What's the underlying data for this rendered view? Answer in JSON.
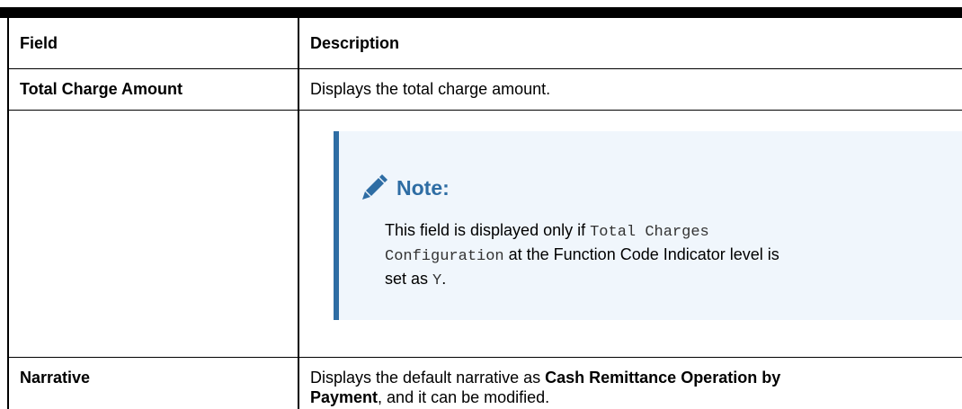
{
  "table": {
    "headers": {
      "field": "Field",
      "description": "Description"
    },
    "rows": [
      {
        "field": "Total Charge Amount",
        "description": "Displays the total charge amount.",
        "note": {
          "title": "Note:",
          "text_1": "This field is displayed only if ",
          "code_1": "Total Charges",
          "code_2": "Configuration",
          "text_2": " at the Function Code Indicator level is",
          "text_3": "set as ",
          "code_3": "Y",
          "text_4": "."
        }
      },
      {
        "field": "Narrative",
        "description_prefix": "Displays the default narrative as ",
        "description_bold_1": "Cash Remittance Operation by",
        "description_bold_2": "Payment",
        "description_suffix": ", and it can be modified."
      }
    ]
  },
  "colors": {
    "note_accent": "#2e6da4",
    "note_background": "#f0f6fc"
  },
  "icons": {
    "note": "pencil-icon"
  }
}
